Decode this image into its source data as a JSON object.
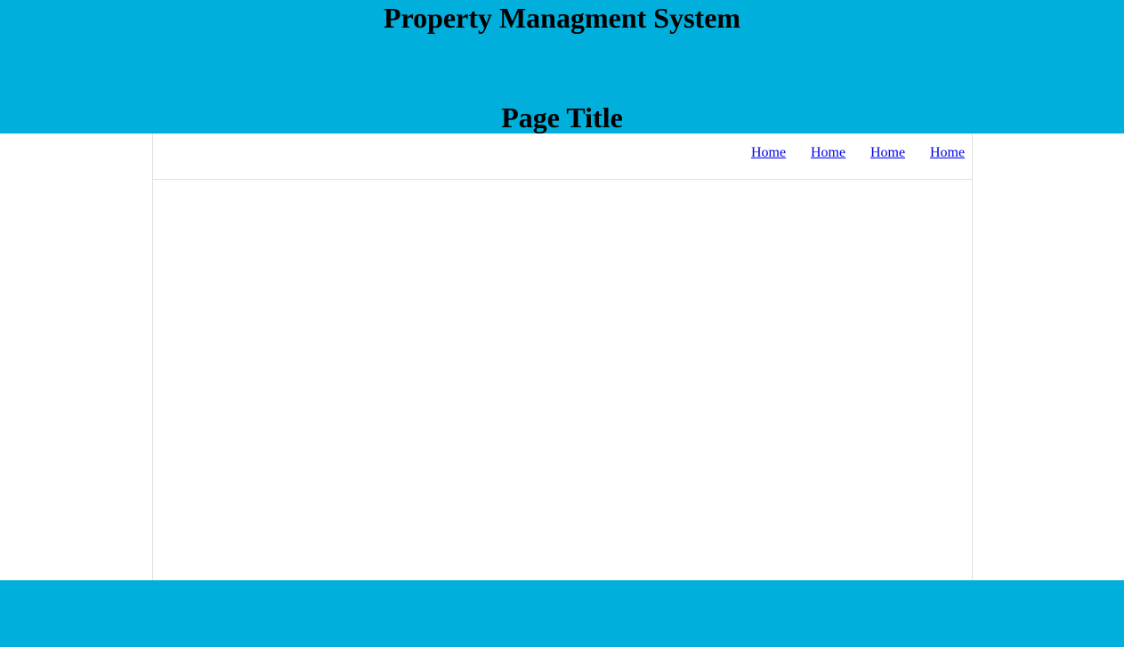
{
  "header": {
    "site_title": "Property Managment System",
    "page_title": "Page Title",
    "background_color": "#00afdb"
  },
  "nav": {
    "links": [
      {
        "label": "Home"
      },
      {
        "label": "Home"
      },
      {
        "label": "Home"
      },
      {
        "label": "Home"
      }
    ]
  },
  "footer": {
    "background_color": "#00afdb"
  },
  "colors": {
    "link": "#0000ee",
    "border": "#e0e0e0"
  }
}
